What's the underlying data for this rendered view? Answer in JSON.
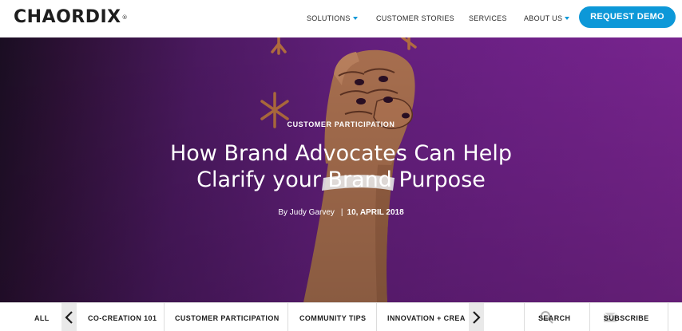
{
  "header": {
    "logo": "CHAORDIX",
    "logo_mark": "®",
    "nav": [
      {
        "label": "SOLUTIONS",
        "has_dropdown": true
      },
      {
        "label": "CUSTOMER STORIES",
        "has_dropdown": false
      },
      {
        "label": "SERVICES",
        "has_dropdown": false
      },
      {
        "label": "ABOUT US",
        "has_dropdown": true
      }
    ],
    "cta_label": "REQUEST DEMO"
  },
  "hero": {
    "category": "CUSTOMER PARTICIPATION",
    "title_line1": "How Brand Advocates Can Help",
    "title_line2": "Clarify your Brand Purpose",
    "author": "By Judy Garvey",
    "separator": "|",
    "date": "10, APRIL 2018",
    "illustration": "raised-fist-icon"
  },
  "category_bar": {
    "all_label": "ALL",
    "items": [
      "CO-CREATION 101",
      "CUSTOMER PARTICIPATION",
      "COMMUNITY TIPS",
      "INNOVATION + CREA"
    ],
    "search_label": "SEARCH",
    "subscribe_label": "SUBSCRIBE"
  },
  "colors": {
    "accent": "#0d98d8",
    "hero_purple": "#6e2187",
    "arm": "#a86f4f",
    "nails": "#2a0f24",
    "asterisk": "#c07a36"
  }
}
